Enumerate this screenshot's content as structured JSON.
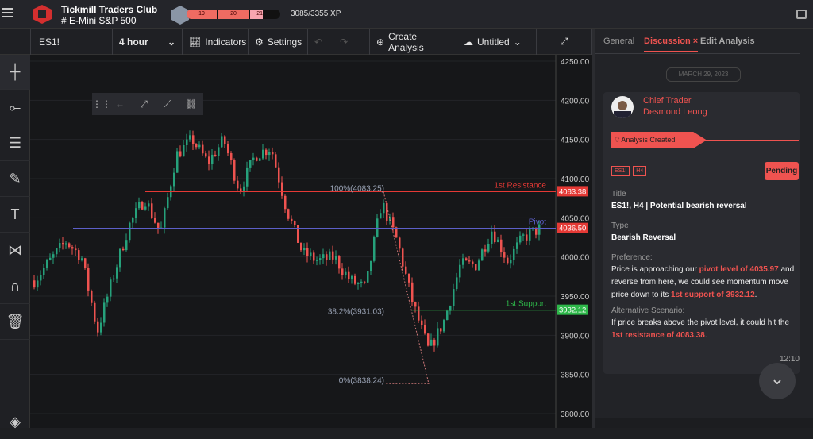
{
  "header": {
    "app_title": "Tickmill Traders Club",
    "channel": "E-Mini S&P 500",
    "levels": [
      "19",
      "20",
      "21"
    ],
    "xp": "3085/3355 XP",
    "xp_progress": 0.92
  },
  "toolbar": {
    "symbol": "ES1!",
    "interval": "4 hour",
    "indicators": "Indicators",
    "settings": "Settings",
    "create_analysis": "Create Analysis",
    "layout_name": "Untitled"
  },
  "tools": [
    "crosshair-icon",
    "line-icon",
    "horizontal-lines-icon",
    "brush-icon",
    "text-icon",
    "pattern-icon",
    "magnet-icon",
    "trash-icon",
    "layers-icon"
  ],
  "chart_data": {
    "type": "candlestick",
    "y_ticks": [
      "4250.00",
      "4200.00",
      "4150.00",
      "4100.00",
      "4050.00",
      "4000.00",
      "3950.00",
      "3900.00",
      "3850.00",
      "3800.00"
    ],
    "ylim": [
      3800,
      4250
    ],
    "price_path": [
      3970,
      3995,
      4020,
      4000,
      3905,
      3975,
      4040,
      4075,
      4030,
      4130,
      4150,
      4120,
      4150,
      4085,
      4130,
      4140,
      4060,
      4005,
      3995,
      4000,
      3970,
      3960,
      4070,
      4020,
      3940,
      3880,
      3920,
      3990,
      3990,
      4035,
      3995,
      4025,
      4036
    ],
    "levels": [
      {
        "name": "1st Resistance",
        "value": 4083.38,
        "label": "4083.38",
        "color": "#e53935"
      },
      {
        "name": "Pivot",
        "value": 4036.5,
        "label": "4036.50",
        "color": "#5c5fc8"
      },
      {
        "name": "1st Support",
        "value": 3932.12,
        "label": "3932.12",
        "color": "#2eb84a"
      }
    ],
    "fib": [
      {
        "label": "100%(4083.25)",
        "value": 4083.25
      },
      {
        "label": "38.2%(3931.03)",
        "value": 3931.03
      },
      {
        "label": "0%(3838.24)",
        "value": 3838.24
      }
    ],
    "colors": {
      "up": "#26a17b",
      "down": "#ef5350"
    }
  },
  "panel": {
    "tabs": [
      "General",
      "Discussion",
      "Edit Analysis"
    ],
    "active_tab": "Discussion",
    "date": "MARCH 29, 2023",
    "author_role": "Chief Trader",
    "author_name": "Desmond Leong",
    "event": "Analysis Created",
    "tags": [
      "ES1!",
      "H4"
    ],
    "status": "Pending",
    "title_label": "Title",
    "title": "ES1!, H4 | Potential bearish reversal",
    "type_label": "Type",
    "type": "Bearish Reversal",
    "pref_label": "Preference:",
    "pref": [
      "Price is approaching our ",
      "pivot level of 4035.97",
      " and reverse from here, we could see momentum move price down to its ",
      "1st support of 3932.12",
      "."
    ],
    "alt_label": "Alternative Scenario:",
    "alt": [
      "If price breaks above the pivot level, it could hit the ",
      "1st resistance of 4083.38",
      "."
    ],
    "time": "12:10"
  },
  "accent": "#ef5350"
}
